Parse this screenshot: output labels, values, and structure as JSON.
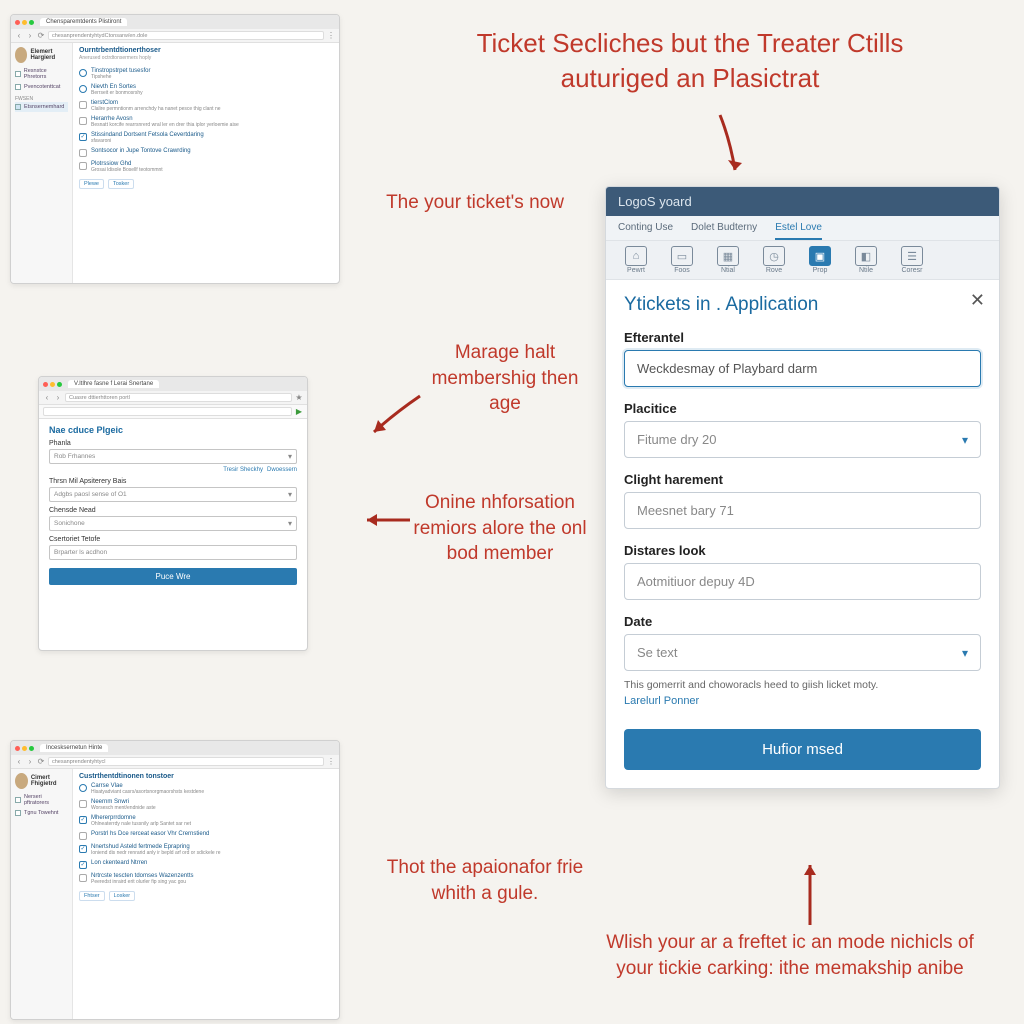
{
  "annotations": {
    "title": "Ticket Secliches but the Treater Ctills auturiged an Plasictrat",
    "a1": "The your ticket's now",
    "a2": "Marage halt membershig then age",
    "a3": "Onine nhforsation remiors alore the onl bod member",
    "a4": "Thot the apaionafor frie whith a gule.",
    "a5": "Wlish your ar a freftet ic an mode nichicls of your tickie carking: ithe memakship anibe"
  },
  "thumb1": {
    "tab": "Chensparemtdents Plistiront",
    "url": "chesanprendentyhtydCtonsarw/en.dole",
    "side_name": "Elemert Hargierd",
    "side_items": [
      "Resnstce Phretorrs",
      "Pvencotenttcat"
    ],
    "side_hdr": "Fwsen",
    "side_sub": "Etsnsernemhard",
    "title": "Ourntrbentdtionerthoser",
    "subtitle": "Anerused octrdtonsermers hoply",
    "rows": [
      {
        "t": "Tinstropstrpet tusesfor",
        "s": "Tipshehe",
        "k": "cir"
      },
      {
        "t": "Nievth En Sortes",
        "s": "Berrseit er bonmosrshy",
        "k": "cir"
      },
      {
        "t": "tierstClom",
        "s": "Clalire permntionm arrenchdy ha nanet pesce thig clant ne",
        "k": "cb"
      },
      {
        "t": "Herarrhe Avosn",
        "s": "Besnatt korcife rearrsnrerd wral ler en drer thia iplor yerloemie aise",
        "k": "cb"
      },
      {
        "t": "Stissindand Dortsent Fetsola Cevertdaring",
        "s": "sfavaroni",
        "k": "ck"
      },
      {
        "t": "Sontsocor in Jupe Tontove Crawrding",
        "s": "",
        "k": "cb"
      },
      {
        "t": "Plotrssiow Ghd",
        "s": "Grosai ldisole Bosellf teotommnt",
        "k": "cb"
      }
    ],
    "foot": [
      "Plewe",
      "Tosker"
    ]
  },
  "thumb2": {
    "tab": "V.Itlhre fasne f Lerai Snertane",
    "url": "Cuasre dttierhttoren portl",
    "title": "Nae cduce Plgeic",
    "l1": "Phanla",
    "v1": "Rob Frhannes",
    "links": [
      "Tresir Sheckhy",
      "Dwoessern"
    ],
    "l2": "Thrsn Mil Apsiterery Bais",
    "v2": "Adgbs paosl sense of O1",
    "l3": "Chensde Nead",
    "v3": "Sonichone",
    "l4": "Csertoriet Tetofe",
    "v4": "Brparter ls acdhon",
    "btn": "Puce Wre"
  },
  "thumb3": {
    "tab": "Incesksernetun  Hinte",
    "url": "chesanprendentyhtycl",
    "side_name": "Cimert Fhigietrd",
    "side_items": [
      "Nerseri pftratorers",
      "Tgnu Towehnt"
    ],
    "title": "Custrthentdtinonen tonstoer",
    "rows": [
      {
        "t": "Carrse Vlae",
        "s": "Hisatyadviant casrs/asortsnorgmaorshsts kestdene",
        "k": "cir"
      },
      {
        "t": "Neernm Snwri",
        "s": "Worsesch ment/endnide aste",
        "k": "cb"
      },
      {
        "t": "Mhererprrdomne",
        "s": "Ohlneaterrdy nale tussnily arlp Santet sar net",
        "k": "ck"
      },
      {
        "t": "Porstrl hs Dce rerceat easor Vhr Crernstiend",
        "s": "",
        "k": "cb"
      },
      {
        "t": "Nnertshud Asteld fertmede Eprapring",
        "s": "Ioniend dis nedr renrarid anly ir bepld arf ord or sdickele re",
        "k": "ck"
      },
      {
        "t": "Lon ckenteard Ntrren",
        "s": "",
        "k": "ck"
      },
      {
        "t": "Nrtrcste tescten tdomses Wazenzentts",
        "s": "Peeredst inraird erit olurler fip sing yac gou",
        "k": "cb"
      }
    ],
    "foot": [
      "Fhtser",
      "Losker"
    ]
  },
  "mainform": {
    "header": "LogoS yoard",
    "nav": [
      "Conting Use",
      "Dolet Budterny",
      "Estel Love"
    ],
    "icons": [
      "Pewrt",
      "Foos",
      "Ntial",
      "Rove",
      "Prop",
      "Ntile",
      "Coresr"
    ],
    "title": "Ytickets in . Application",
    "l1": "Efterantel",
    "v1": "Weckdesmay of Playbard darm",
    "l2": "Placitice",
    "v2": "Fitume dry 20",
    "l3": "Clight harement",
    "v3": "Meesnet bary 71",
    "l4": "Distares look",
    "v4": "Aotmitiuor depuy 4D",
    "l5": "Date",
    "v5": "Se text",
    "help": "This gomerrit and choworacls heed to giish licket moty.",
    "link": "Larelurl Ponner",
    "submit": "Hufior msed"
  }
}
